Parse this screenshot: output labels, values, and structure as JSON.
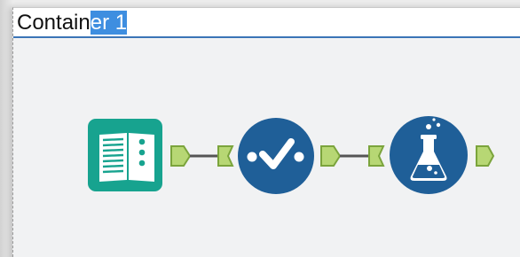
{
  "container": {
    "title_prefix": "Contain",
    "title_selected": "er 1"
  },
  "tools": [
    {
      "name": "input-data-tool",
      "icon": "book-icon",
      "color": "#17a38f"
    },
    {
      "name": "select-tool",
      "icon": "checkmark-dots-icon",
      "color": "#1f5f98"
    },
    {
      "name": "formula-tool",
      "icon": "flask-icon",
      "color": "#1f5f98"
    }
  ],
  "colors": {
    "anchor": "#b7d774",
    "anchor_stroke": "#7ba43c",
    "connector": "#555555",
    "selection": "#3e8ee0",
    "container_border": "#3b74b6"
  }
}
